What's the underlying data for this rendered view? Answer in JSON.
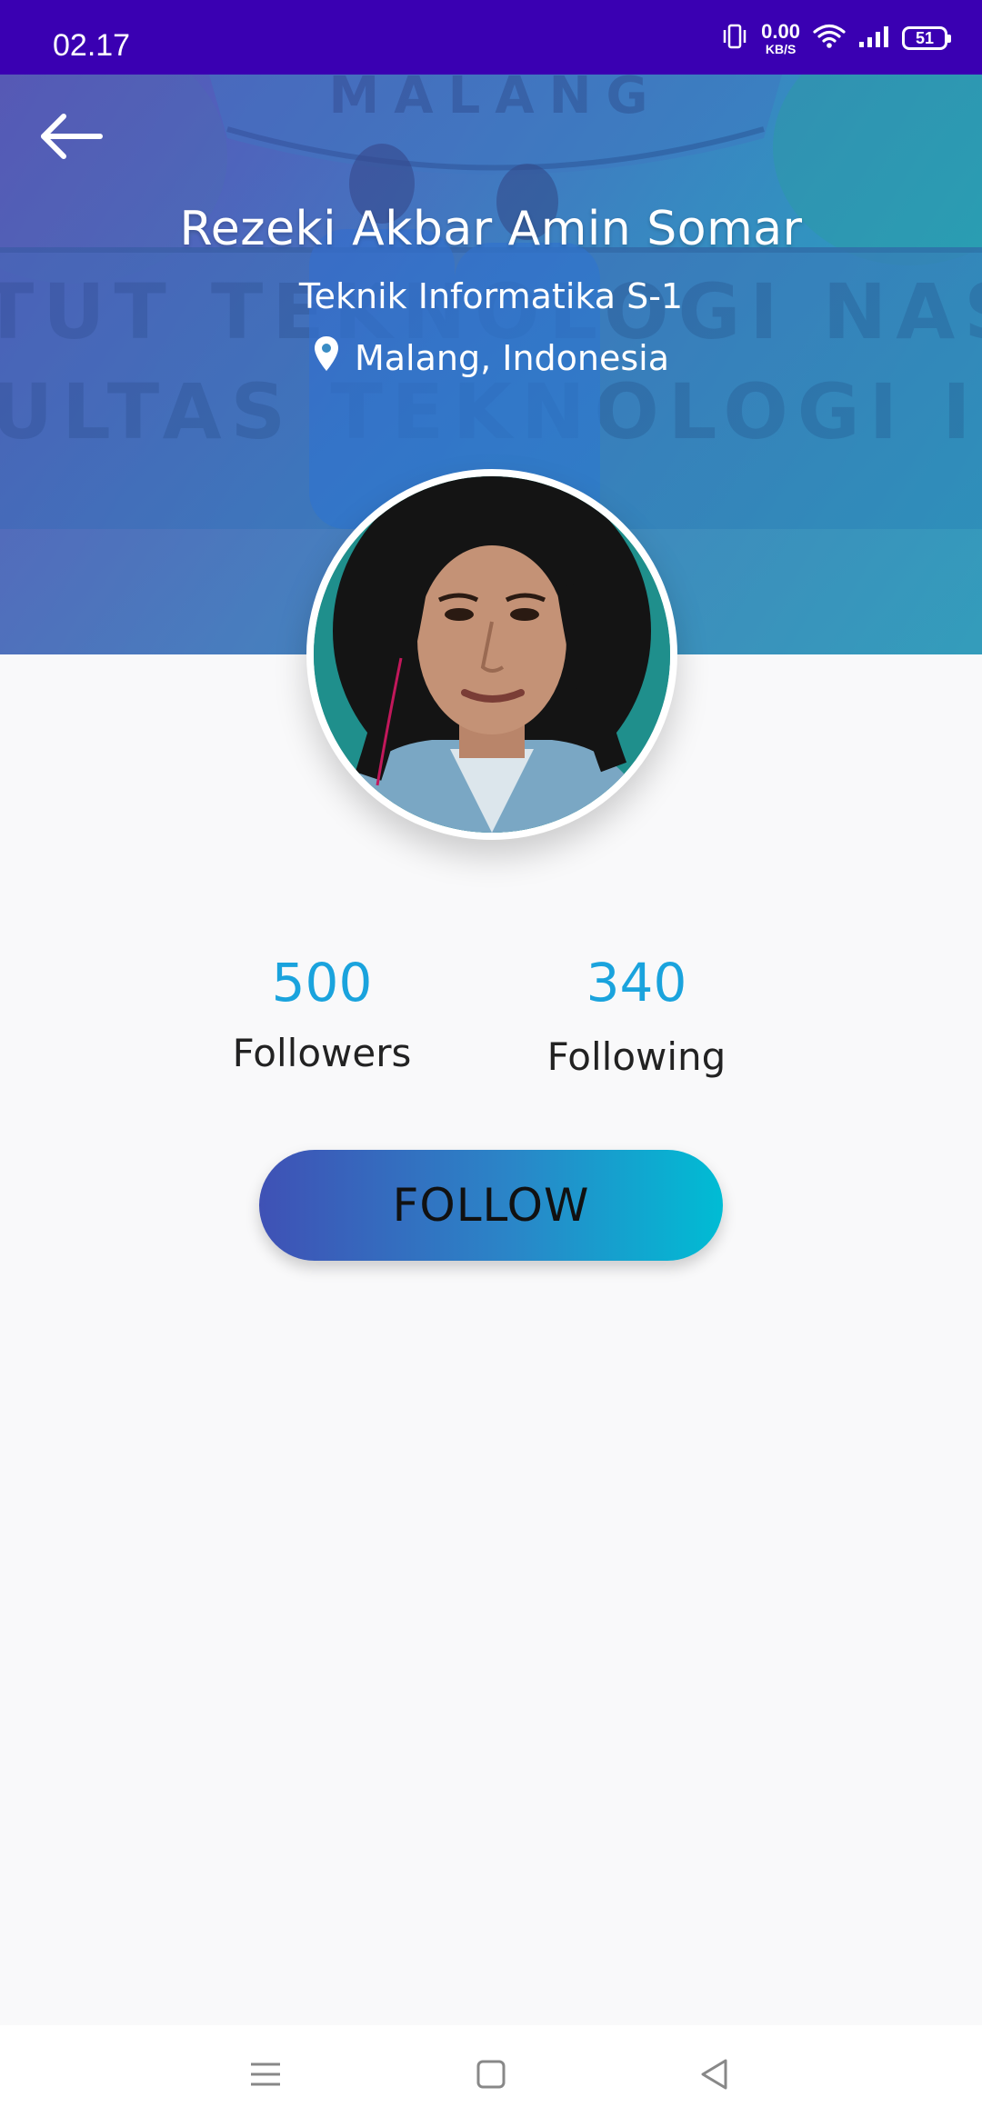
{
  "status_bar": {
    "time": "02.17",
    "net_speed_value": "0.00",
    "net_speed_unit": "KB/S",
    "battery_level": "51"
  },
  "header": {
    "name": "Rezeki Akbar Amin Somar",
    "major": "Teknik Informatika S-1",
    "location": "Malang, Indonesia"
  },
  "stats": {
    "followers_count": "500",
    "followers_label": "Followers",
    "following_count": "340",
    "following_label": "Following"
  },
  "actions": {
    "follow_label": "FOLLOW"
  },
  "colors": {
    "status_bar": "#3a00b2",
    "stat_value": "#1aa3dd",
    "button_gradient_start": "#3f51b5",
    "button_gradient_end": "#00bcd4"
  },
  "icons": {
    "back": "arrow-left-icon",
    "location": "location-pin-icon",
    "nav_menu": "menu-icon",
    "nav_home": "square-home-icon",
    "nav_back": "triangle-back-icon"
  }
}
